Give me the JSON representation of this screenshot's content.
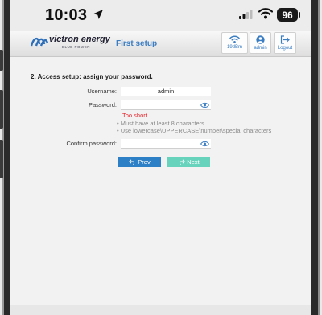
{
  "status_bar": {
    "time": "10:03",
    "battery": "96"
  },
  "header": {
    "logo_text": "victron energy",
    "logo_sub": "BLUE POWER",
    "title": "First setup",
    "wifi_label": "19dBm",
    "user_label": "admin",
    "logout_label": "Logout"
  },
  "form": {
    "section_title": "2. Access setup: assign your password.",
    "username_label": "Username:",
    "username_value": "admin",
    "password_label": "Password:",
    "password_value": "",
    "error": "Too short",
    "hints": [
      "Must have at least 8 characters",
      "Use lowercase\\UPPERCASE\\number\\special characters"
    ],
    "confirm_label": "Confirm password:",
    "confirm_value": ""
  },
  "buttons": {
    "prev": "Prev",
    "next": "Next"
  },
  "colors": {
    "accent": "#2d7fc6",
    "next": "#68d3bc",
    "error": "#e8262d",
    "heading": "#3b7dc2"
  }
}
